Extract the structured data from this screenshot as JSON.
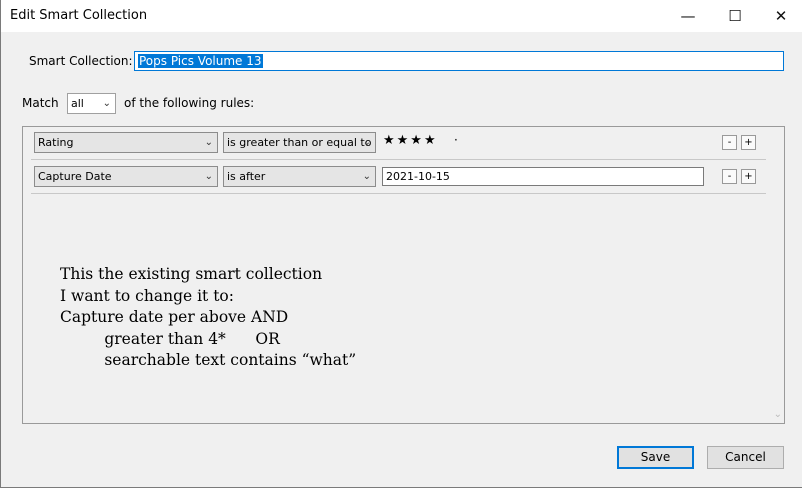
{
  "window": {
    "title": "Edit Smart Collection",
    "minimize_glyph": "—",
    "maximize_glyph": "☐",
    "close_glyph": "✕"
  },
  "form": {
    "name_label": "Smart Collection:",
    "name_value": "Pops Pics Volume 13",
    "match_label": "Match",
    "match_value": "all",
    "match_suffix": "of the following rules:"
  },
  "rules": [
    {
      "field": "Rating",
      "operator": "is greater than or equal to",
      "stars": "★★★★",
      "extra": "·"
    },
    {
      "field": "Capture Date",
      "operator": "is after",
      "value": "2021-10-15"
    }
  ],
  "rule_buttons": {
    "remove": "-",
    "add": "+"
  },
  "note": [
    "This the existing smart collection",
    "I want to change it to:",
    "Capture date per above AND",
    "         greater than 4*      OR",
    "         searchable text contains “what”"
  ],
  "buttons": {
    "save": "Save",
    "cancel": "Cancel"
  }
}
